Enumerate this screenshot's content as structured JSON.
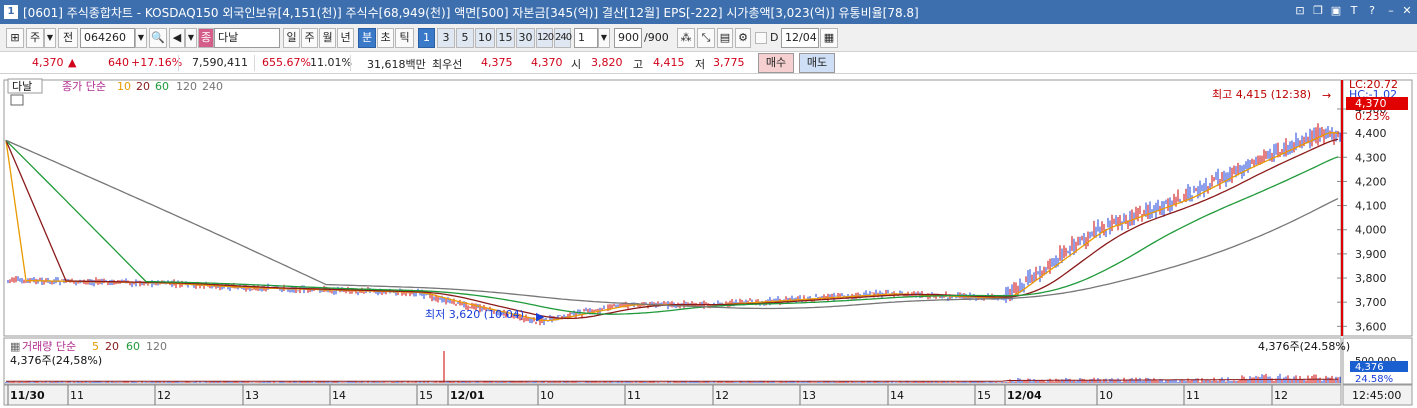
{
  "window": {
    "number": "1",
    "title": "[0601] 주식종합차트 - KOSDAQ150 외국인보유[4,151(천)] 주식수[68,949(천)] 액면[500] 자본금[345(억)] 결산[12월] EPS[-222] 시가총액[3,023(억)] 유통비율[78.8]"
  },
  "toolbar": {
    "type_label": "주",
    "jeon_label": "전",
    "code": "064260",
    "stock_name": "다날",
    "period_tabs": [
      "일",
      "주",
      "월",
      "년",
      "분",
      "초",
      "틱"
    ],
    "selected_period": "분",
    "intervals": [
      "1",
      "3",
      "5",
      "10",
      "15",
      "30",
      "120",
      "240"
    ],
    "selected_interval": "1",
    "interval_value": "1",
    "count_value": "900",
    "count_total": "/900",
    "date_value": "12/04"
  },
  "quote": {
    "price": "4,370",
    "change": "640",
    "change_pct": "+17.16%",
    "volume": "7,590,411",
    "vol_ratio": "655.67%",
    "turnover": "11.01%",
    "amount": "31,618백만",
    "best_label": "최우선",
    "ask": "4,375",
    "bid": "4,370",
    "open_label": "시",
    "open": "3,820",
    "high_label": "고",
    "high": "4,415",
    "low_label": "저",
    "low": "3,775",
    "buy_label": "매수",
    "sell_label": "매도"
  },
  "chart": {
    "name_tag": "다날",
    "ma_label": "종가 단순",
    "ma_periods": [
      "10",
      "20",
      "60",
      "120",
      "240"
    ],
    "high_note": "최고 4,415 (12:38)",
    "low_note": "최저 3,620 (10:04)",
    "lc_text": "LC:20.72",
    "hc_text": "HC:-1.02",
    "cur_price": "4,370",
    "cur_pct": "0.23%",
    "y_ticks": [
      "4,500",
      "4,400",
      "4,300",
      "4,200",
      "4,100",
      "4,000",
      "3,900",
      "3,800",
      "3,700",
      "3,600"
    ],
    "vol_label": "거래량 단순",
    "vol_ma": [
      "5",
      "20",
      "60",
      "120"
    ],
    "vol_value": "4,376주(24,58%)",
    "vol_value_right": "4,376주(24.58%)",
    "vol_axis_top": "500,000",
    "vol_cur": "4,376",
    "vol_pct": "24.58%",
    "time_labels": [
      "11/30",
      "11",
      "12",
      "13",
      "14",
      "15",
      "12/01",
      "10",
      "11",
      "12",
      "13",
      "14",
      "15",
      "12/04",
      "10",
      "11",
      "12"
    ],
    "time_corner": "12:45:00",
    "colors": {
      "ma5": "#e89a00",
      "ma20": "#8b1a1a",
      "ma60": "#1f9a3a",
      "ma120": "#777777",
      "candle_up": "#cc0000",
      "candle_down": "#1a3fd8",
      "price_tag": "#e00000"
    }
  },
  "chart_data": {
    "type": "line",
    "title": "다날",
    "xlabel": "",
    "ylabel": "",
    "x": [
      "11/30 09:00",
      "11/30 11:00",
      "11/30 13:00",
      "11/30 15:00",
      "12/01 09:00",
      "12/01 10:04",
      "12/01 11:00",
      "12/01 13:00",
      "12/01 14:00",
      "12/01 15:00",
      "12/04 09:00",
      "12/04 10:00",
      "12/04 11:00",
      "12/04 12:00",
      "12/04 12:38",
      "12/04 12:45"
    ],
    "series": [
      {
        "name": "종가",
        "values": [
          3790,
          3780,
          3760,
          3740,
          3705,
          3620,
          3690,
          3690,
          3735,
          3720,
          3720,
          4000,
          4130,
          4250,
          4415,
          4370
        ]
      }
    ],
    "ylim": [
      3560,
      4620
    ]
  }
}
